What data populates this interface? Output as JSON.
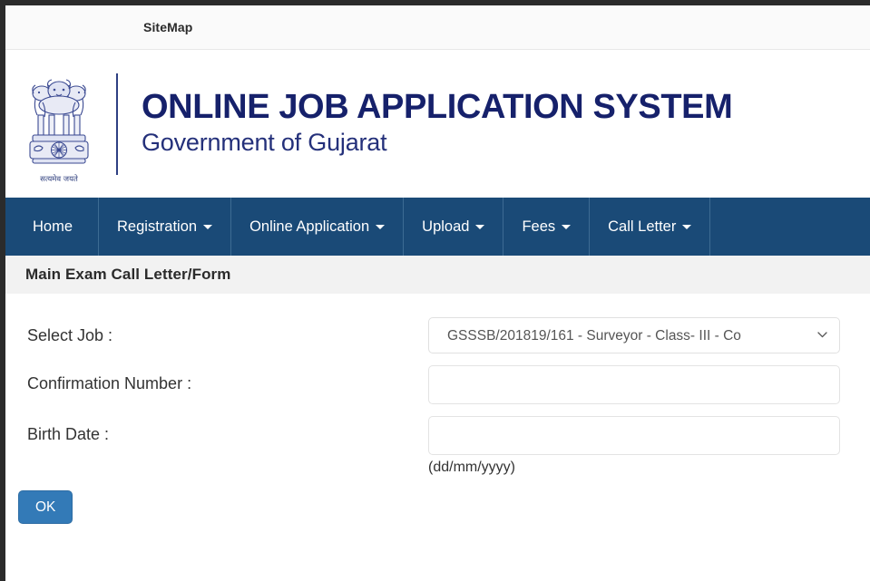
{
  "utility_bar": {
    "sitemap_label": "SiteMap"
  },
  "masthead": {
    "emblem_icon": "india-state-emblem-icon",
    "emblem_motto": "सत्यमेव जयते",
    "title": "ONLINE JOB APPLICATION SYSTEM",
    "subtitle": "Government of Gujarat",
    "title_color": "#16216b"
  },
  "navbar": {
    "background_color": "#1a4a77",
    "items": [
      {
        "label": "Home",
        "has_caret": false
      },
      {
        "label": "Registration",
        "has_caret": true
      },
      {
        "label": "Online Application",
        "has_caret": true
      },
      {
        "label": "Upload",
        "has_caret": true
      },
      {
        "label": "Fees",
        "has_caret": true
      },
      {
        "label": "Call Letter",
        "has_caret": true
      }
    ]
  },
  "page": {
    "heading": "Main Exam Call Letter/Form"
  },
  "form": {
    "select_job": {
      "label": "Select Job :",
      "selected_value": "GSSSB/201819/161 - Surveyor - Class- III - Co",
      "chevron_icon": "chevron-down-icon"
    },
    "confirmation_number": {
      "label": "Confirmation Number :",
      "value": "",
      "placeholder": ""
    },
    "birth_date": {
      "label": "Birth Date :",
      "value": "",
      "placeholder": "",
      "hint": "(dd/mm/yyyy)"
    },
    "submit": {
      "label": "OK",
      "color": "#337ab7"
    }
  }
}
